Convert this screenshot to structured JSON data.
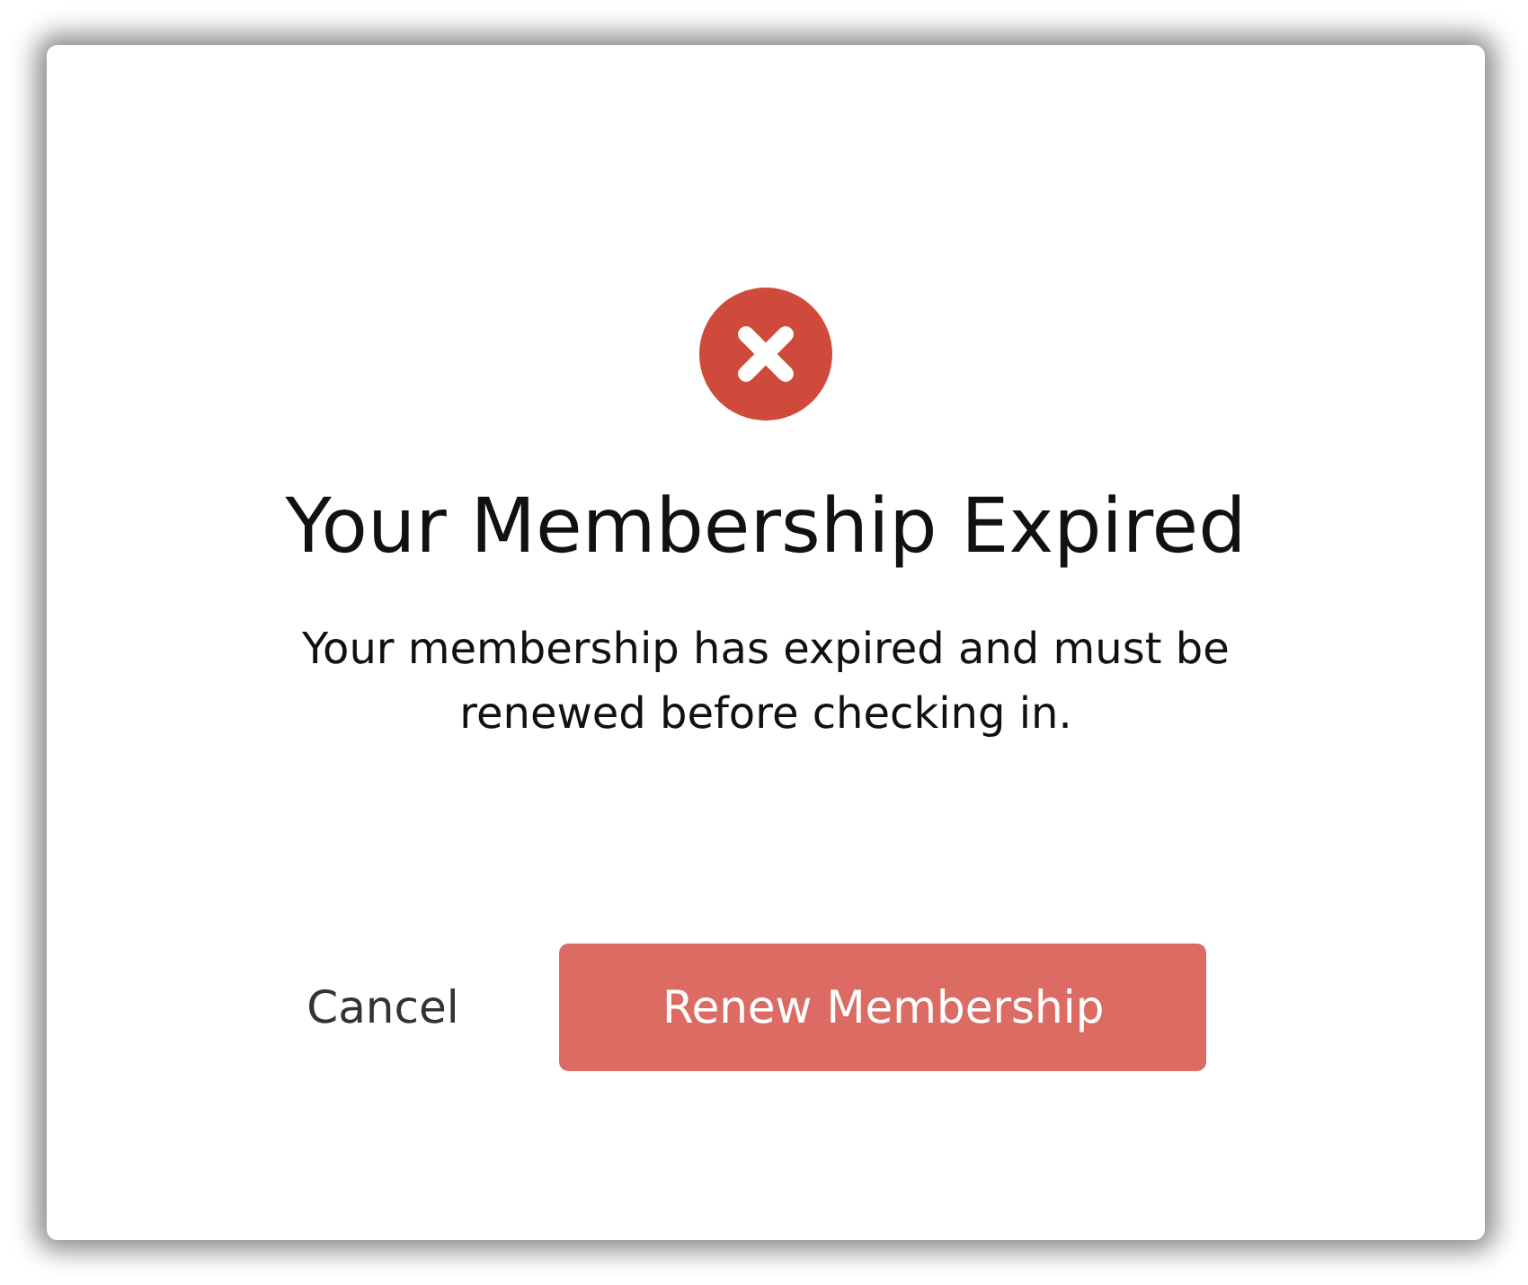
{
  "dialog": {
    "kind": "error",
    "title": "Your Membership Expired",
    "message": "Your membership has expired and must be renewed before checking in.",
    "buttons": [
      {
        "label": "Cancel",
        "kind": "text"
      },
      {
        "label": "Renew Membership",
        "kind": "primary"
      }
    ]
  }
}
